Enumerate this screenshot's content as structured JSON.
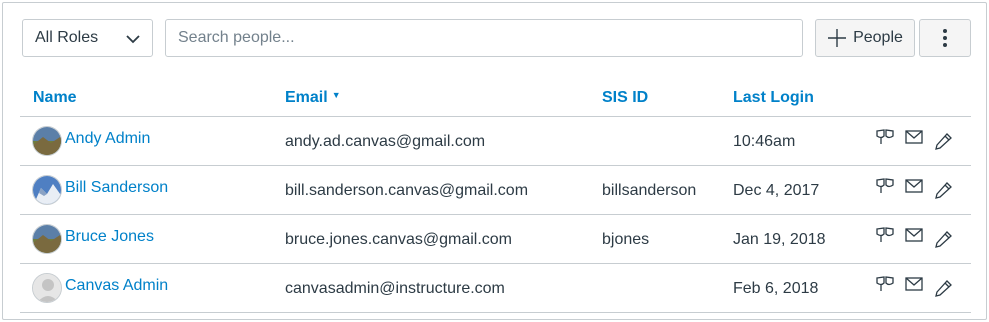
{
  "toolbar": {
    "role_filter": "All Roles",
    "search_placeholder": "Search people...",
    "people_button_label": "People"
  },
  "table": {
    "columns": [
      "Name",
      "Email",
      "SIS ID",
      "Last Login"
    ],
    "sorted_column": "Email",
    "rows": [
      {
        "name": "Andy Admin",
        "email": "andy.ad.canvas@gmail.com",
        "sis_id": "",
        "last_login": "10:46am"
      },
      {
        "name": "Bill Sanderson",
        "email": "bill.sanderson.canvas@gmail.com",
        "sis_id": "billsanderson",
        "last_login": "Dec 4, 2017"
      },
      {
        "name": "Bruce Jones",
        "email": "bruce.jones.canvas@gmail.com",
        "sis_id": "bjones",
        "last_login": "Jan 19, 2018"
      },
      {
        "name": "Canvas Admin",
        "email": "canvasadmin@instructure.com",
        "sis_id": "",
        "last_login": "Feb 6, 2018"
      }
    ]
  },
  "icons": {
    "role_dropdown": "chevron-down-icon",
    "add_people": "plus-icon",
    "more_options": "vertical-ellipsis-icon",
    "row_actions": [
      "masquerade-icon",
      "envelope-icon",
      "pencil-icon"
    ]
  },
  "colors": {
    "link": "#0081c9",
    "text": "#2d3b45",
    "border": "#c7cdd1",
    "button_bg": "#f5f5f5"
  }
}
